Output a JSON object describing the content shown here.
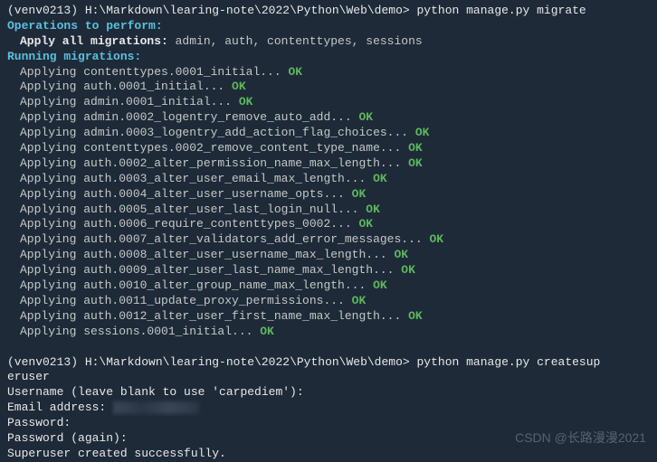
{
  "prompt1": {
    "venv": "(venv0213)",
    "path": "H:\\Markdown\\learing-note\\2022\\Python\\Web\\demo>",
    "command": "python manage.py migrate"
  },
  "operations_header": "Operations to perform:",
  "apply_all_label": "Apply all migrations:",
  "apply_all_list": " admin, auth, contenttypes, sessions",
  "running_header": "Running migrations:",
  "migrations": [
    {
      "text": "Applying contenttypes.0001_initial... ",
      "status": "OK"
    },
    {
      "text": "Applying auth.0001_initial... ",
      "status": "OK"
    },
    {
      "text": "Applying admin.0001_initial... ",
      "status": "OK"
    },
    {
      "text": "Applying admin.0002_logentry_remove_auto_add... ",
      "status": "OK"
    },
    {
      "text": "Applying admin.0003_logentry_add_action_flag_choices... ",
      "status": "OK"
    },
    {
      "text": "Applying contenttypes.0002_remove_content_type_name... ",
      "status": "OK"
    },
    {
      "text": "Applying auth.0002_alter_permission_name_max_length... ",
      "status": "OK"
    },
    {
      "text": "Applying auth.0003_alter_user_email_max_length... ",
      "status": "OK"
    },
    {
      "text": "Applying auth.0004_alter_user_username_opts... ",
      "status": "OK"
    },
    {
      "text": "Applying auth.0005_alter_user_last_login_null... ",
      "status": "OK"
    },
    {
      "text": "Applying auth.0006_require_contenttypes_0002... ",
      "status": "OK"
    },
    {
      "text": "Applying auth.0007_alter_validators_add_error_messages... ",
      "status": "OK"
    },
    {
      "text": "Applying auth.0008_alter_user_username_max_length... ",
      "status": "OK"
    },
    {
      "text": "Applying auth.0009_alter_user_last_name_max_length... ",
      "status": "OK"
    },
    {
      "text": "Applying auth.0010_alter_group_name_max_length... ",
      "status": "OK"
    },
    {
      "text": "Applying auth.0011_update_proxy_permissions... ",
      "status": "OK"
    },
    {
      "text": "Applying auth.0012_alter_user_first_name_max_length... ",
      "status": "OK"
    },
    {
      "text": "Applying sessions.0001_initial... ",
      "status": "OK"
    }
  ],
  "prompt2": {
    "venv": "(venv0213)",
    "path": "H:\\Markdown\\learing-note\\2022\\Python\\Web\\demo>",
    "command": "python manage.py createsup"
  },
  "prompt2_wrap": "eruser",
  "username_prompt": "Username (leave blank to use 'carpediem'):",
  "email_label": "Email address: ",
  "password_label": "Password:",
  "password_again_label": "Password (again):",
  "success_msg": "Superuser created successfully.",
  "watermark": "CSDN @长路漫漫2021"
}
